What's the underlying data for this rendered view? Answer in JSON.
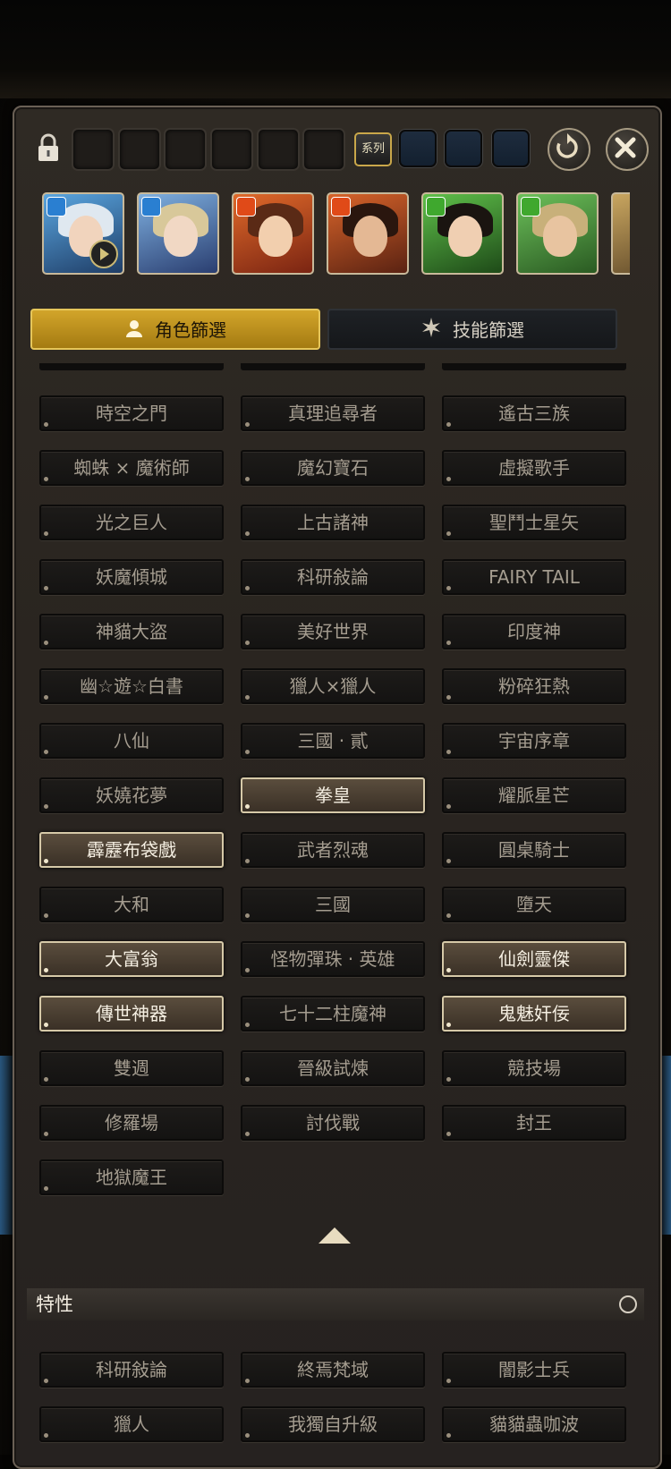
{
  "toolbar": {
    "lock_icon": "lock-icon",
    "series_label": "系列",
    "reset_icon": "refresh-icon",
    "close_icon": "close-icon"
  },
  "portraits": [
    {
      "element": "water",
      "color": "#2a7fd1"
    },
    {
      "element": "water",
      "color": "#2a7fd1"
    },
    {
      "element": "fire",
      "color": "#e04a18"
    },
    {
      "element": "fire",
      "color": "#e04a18"
    },
    {
      "element": "wood",
      "color": "#3fa82e"
    },
    {
      "element": "wood",
      "color": "#3fa82e"
    }
  ],
  "tabs": {
    "role_filter": "角色篩選",
    "skill_filter": "技能篩選"
  },
  "series_buttons": [
    {
      "label": "時空之門",
      "selected": false
    },
    {
      "label": "真理追尋者",
      "selected": false
    },
    {
      "label": "遙古三族",
      "selected": false
    },
    {
      "label": "蜘蛛 × 魔術師",
      "selected": false
    },
    {
      "label": "魔幻寶石",
      "selected": false
    },
    {
      "label": "虛擬歌手",
      "selected": false
    },
    {
      "label": "光之巨人",
      "selected": false
    },
    {
      "label": "上古諸神",
      "selected": false
    },
    {
      "label": "聖鬥士星矢",
      "selected": false
    },
    {
      "label": "妖魔傾城",
      "selected": false
    },
    {
      "label": "科研敍論",
      "selected": false
    },
    {
      "label": "FAIRY TAIL",
      "selected": false
    },
    {
      "label": "神貓大盜",
      "selected": false
    },
    {
      "label": "美好世界",
      "selected": false
    },
    {
      "label": "印度神",
      "selected": false
    },
    {
      "label": "幽☆遊☆白書",
      "selected": false
    },
    {
      "label": "獵人×獵人",
      "selected": false
    },
    {
      "label": "粉碎狂熱",
      "selected": false
    },
    {
      "label": "八仙",
      "selected": false
    },
    {
      "label": "三國 · 貳",
      "selected": false
    },
    {
      "label": "宇宙序章",
      "selected": false
    },
    {
      "label": "妖嬈花夢",
      "selected": false
    },
    {
      "label": "拳皇",
      "selected": true
    },
    {
      "label": "耀脈星芒",
      "selected": false
    },
    {
      "label": "霹靂布袋戲",
      "selected": true
    },
    {
      "label": "武者烈魂",
      "selected": false
    },
    {
      "label": "圓桌騎士",
      "selected": false
    },
    {
      "label": "大和",
      "selected": false
    },
    {
      "label": "三國",
      "selected": false
    },
    {
      "label": "墮天",
      "selected": false
    },
    {
      "label": "大富翁",
      "selected": true
    },
    {
      "label": "怪物彈珠 · 英雄",
      "selected": false
    },
    {
      "label": "仙劍靈傑",
      "selected": true
    },
    {
      "label": "傳世神器",
      "selected": true
    },
    {
      "label": "七十二柱魔神",
      "selected": false
    },
    {
      "label": "鬼魅奸佞",
      "selected": true
    },
    {
      "label": "雙週",
      "selected": false
    },
    {
      "label": "晉級試煉",
      "selected": false
    },
    {
      "label": "競技場",
      "selected": false
    },
    {
      "label": "修羅場",
      "selected": false
    },
    {
      "label": "討伐戰",
      "selected": false
    },
    {
      "label": "封王",
      "selected": false
    },
    {
      "label": "地獄魔王",
      "selected": false
    }
  ],
  "traits_section": {
    "title": "特性",
    "buttons": [
      {
        "label": "科研敍論",
        "selected": false
      },
      {
        "label": "終焉梵域",
        "selected": false
      },
      {
        "label": "闇影士兵",
        "selected": false
      },
      {
        "label": "獵人",
        "selected": false
      },
      {
        "label": "我獨自升級",
        "selected": false
      },
      {
        "label": "貓貓蟲咖波",
        "selected": false
      }
    ]
  }
}
